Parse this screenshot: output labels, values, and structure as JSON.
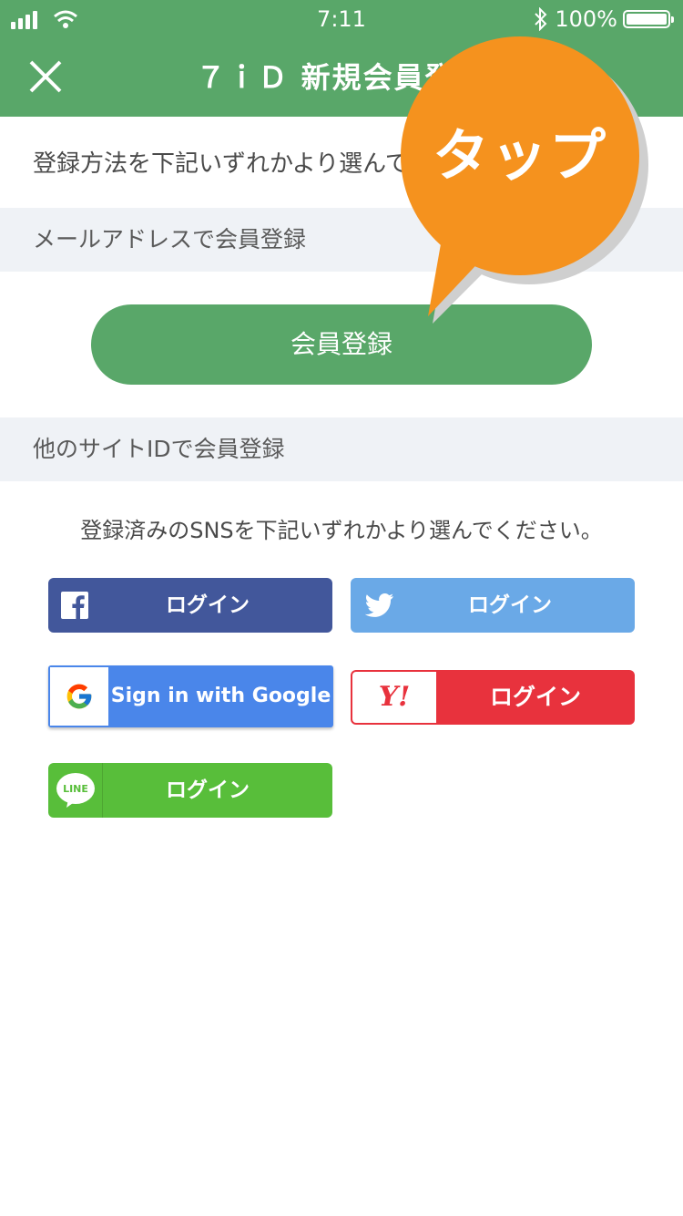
{
  "status_bar": {
    "time": "7:11",
    "battery": "100%",
    "battery_level": 1.0
  },
  "header": {
    "title": "７ｉＤ 新規会員登録",
    "close_icon": "close-icon"
  },
  "intro": "登録方法を下記いずれかより選んでください。",
  "mail_section": {
    "heading": "メールアドレスで会員登録",
    "button": "会員登録"
  },
  "other_section": {
    "heading": "他のサイトIDで会員登録",
    "text": "登録済みのSNSを下記いずれかより選んでください。"
  },
  "sns": {
    "facebook": {
      "label": "ログイン",
      "icon": "facebook-icon",
      "color": "#42579b"
    },
    "twitter": {
      "label": "ログイン",
      "icon": "twitter-icon",
      "color": "#6aa9e7"
    },
    "google": {
      "label": "Sign in with Google",
      "icon": "google-icon",
      "color": "#4a86ea"
    },
    "yahoo": {
      "label": "ログイン",
      "icon": "yahoo-icon",
      "logo_text": "Y!",
      "color": "#e8323d"
    },
    "line": {
      "label": "ログイン",
      "icon": "line-icon",
      "logo_text": "LINE",
      "color": "#58be3a"
    }
  },
  "tooltip": {
    "text": "タップ",
    "color": "#f5921e"
  },
  "colors": {
    "header": "#59a769",
    "section_bg": "#eff2f6"
  }
}
